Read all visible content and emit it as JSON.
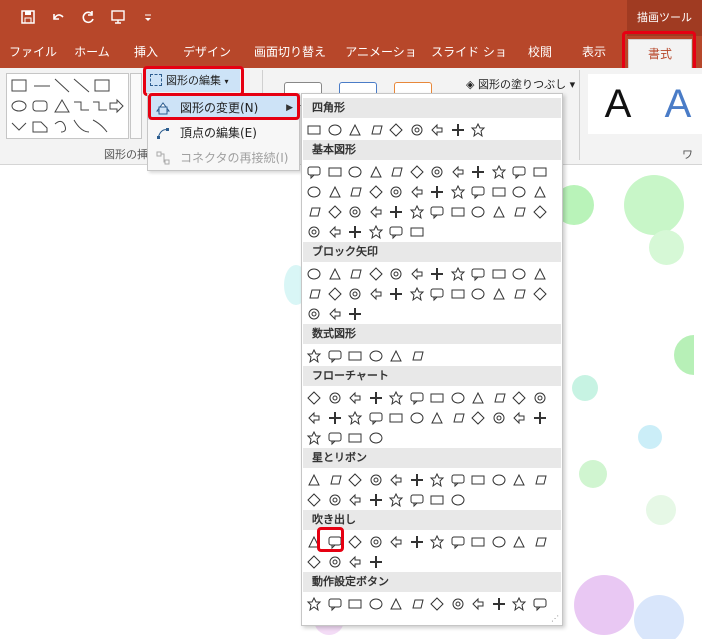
{
  "titlebar": {
    "context_title": "描画ツール"
  },
  "qat": {
    "icons": [
      "save-icon",
      "undo-icon",
      "redo-icon",
      "present-icon",
      "customize-icon"
    ]
  },
  "tabs": [
    {
      "label": "ファイル"
    },
    {
      "label": "ホーム"
    },
    {
      "label": "挿入"
    },
    {
      "label": "デザイン"
    },
    {
      "label": "画面切り替え"
    },
    {
      "label": "アニメーション"
    },
    {
      "label": "スライド ショー"
    },
    {
      "label": "校閲"
    },
    {
      "label": "表示"
    },
    {
      "label": "書式",
      "active": true
    }
  ],
  "ribbon": {
    "edit_shape_label": "図形の編集",
    "group_insert_label": "図形の挿",
    "shape_fill_label": "図形の塗りつぶし",
    "wordart_group_label": "ワー",
    "wordart_samples": [
      "A",
      "A"
    ]
  },
  "submenu": {
    "items": [
      {
        "label": "図形の変更(N)",
        "selected": true
      },
      {
        "label": "頂点の編集(E)"
      },
      {
        "label": "コネクタの再接続(I)",
        "disabled": true
      }
    ]
  },
  "shapes_panel": {
    "sections": [
      {
        "title": "四角形",
        "count": 9
      },
      {
        "title": "基本図形",
        "count": 42
      },
      {
        "title": "ブロック矢印",
        "count": 27
      },
      {
        "title": "数式図形",
        "count": 6
      },
      {
        "title": "フローチャート",
        "count": 28
      },
      {
        "title": "星とリボン",
        "count": 20
      },
      {
        "title": "吹き出し",
        "count": 16
      },
      {
        "title": "動作設定ボタン",
        "count": 12
      }
    ],
    "highlighted_shape": "rounded-rectangle-callout-icon"
  },
  "colors": {
    "accent": "#b7472a",
    "highlight": "#e60012",
    "selected": "#cde3f7"
  }
}
